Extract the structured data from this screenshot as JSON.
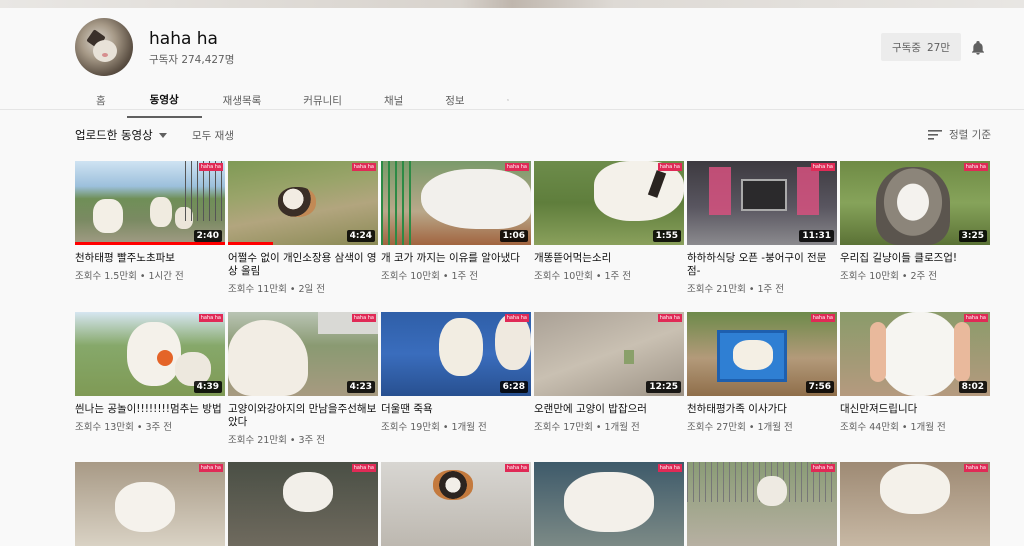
{
  "channel": {
    "name": "haha ha",
    "subscribers": "구독자 274,427명",
    "subscribe_label": "구독중",
    "subscribe_count": "27만"
  },
  "tabs": [
    "홈",
    "동영상",
    "재생목록",
    "커뮤니티",
    "채널",
    "정보"
  ],
  "active_tab": "동영상",
  "toolbar": {
    "uploads_label": "업로드한 동영상",
    "play_all": "모두 재생",
    "sort_label": "정렬 기준"
  },
  "videos": [
    {
      "title": "천하태평 빨주노초파보",
      "meta": "조회수 1.5만회 • 1시간 전",
      "duration": "2:40"
    },
    {
      "title": "어쩔수 없이 개인소장용 삼색이 영상 올림",
      "meta": "조회수 11만회 • 2일 전",
      "duration": "4:24"
    },
    {
      "title": "개 코가 까지는 이유를 알아냈다",
      "meta": "조회수 10만회 • 1주 전",
      "duration": "1:06"
    },
    {
      "title": "개똥뜯어먹는소리",
      "meta": "조회수 10만회 • 1주 전",
      "duration": "1:55"
    },
    {
      "title": "하하하식당 오픈 -붕어구이 전문점-",
      "meta": "조회수 21만회 • 1주 전",
      "duration": "11:31"
    },
    {
      "title": "우리집 길냥이들 클로즈업!",
      "meta": "조회수 10만회 • 2주 전",
      "duration": "3:25"
    },
    {
      "title": "씐나는 공놀이!!!!!!!!멈추는 방법",
      "meta": "조회수 13만회 • 3주 전",
      "duration": "4:39"
    },
    {
      "title": "고양이와강아지의 만남을주선해보았다",
      "meta": "조회수 21만회 • 3주 전",
      "duration": "4:23"
    },
    {
      "title": "더울땐 죽욕",
      "meta": "조회수 19만회 • 1개월 전",
      "duration": "6:28"
    },
    {
      "title": "오랜만에 고양이 밥잡으러",
      "meta": "조회수 17만회 • 1개월 전",
      "duration": "12:25"
    },
    {
      "title": "천하태평가족 이사가다",
      "meta": "조회수 27만회 • 1개월 전",
      "duration": "7:56"
    },
    {
      "title": "대신만져드립니다",
      "meta": "조회수 44만회 • 1개월 전",
      "duration": "8:02"
    },
    {
      "title": "",
      "meta": "",
      "duration": ""
    },
    {
      "title": "",
      "meta": "",
      "duration": ""
    },
    {
      "title": "",
      "meta": "",
      "duration": ""
    },
    {
      "title": "",
      "meta": "",
      "duration": ""
    },
    {
      "title": "",
      "meta": "",
      "duration": ""
    },
    {
      "title": "",
      "meta": "",
      "duration": ""
    }
  ],
  "thumb_logo": "haha ha",
  "colors": {
    "progress": "#ff0000",
    "logo": "#e02a56"
  }
}
